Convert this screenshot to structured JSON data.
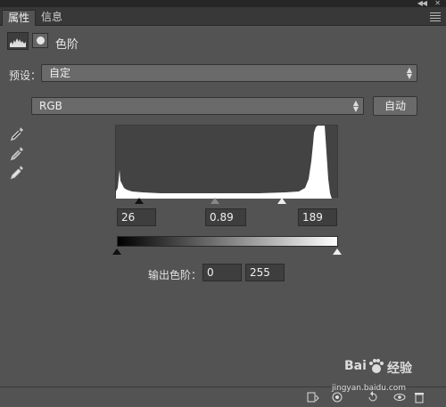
{
  "tabs": [
    {
      "label": "属性",
      "active": true
    },
    {
      "label": "信息",
      "active": false
    }
  ],
  "header": {
    "title": "色阶"
  },
  "preset": {
    "label": "预设：",
    "value": "自定"
  },
  "channel": {
    "value": "RGB"
  },
  "auto_button": {
    "label": "自动"
  },
  "input_levels": {
    "black": "26",
    "gamma": "0.89",
    "white": "189"
  },
  "output_levels": {
    "label": "输出色阶：",
    "black": "0",
    "white": "255"
  },
  "watermark": {
    "brand": "Bai",
    "brand_cn": "经验",
    "url": "jingyan.baidu.com"
  },
  "icons": [
    "collapse-icon",
    "close-icon",
    "panel-menu-icon",
    "levels-adjustment-icon",
    "mask-icon",
    "black-point-eyedropper-icon",
    "gray-point-eyedropper-icon",
    "white-point-eyedropper-icon",
    "clip-to-layer-icon",
    "visibility-icon",
    "reset-icon",
    "view-previous-icon",
    "delete-icon"
  ]
}
